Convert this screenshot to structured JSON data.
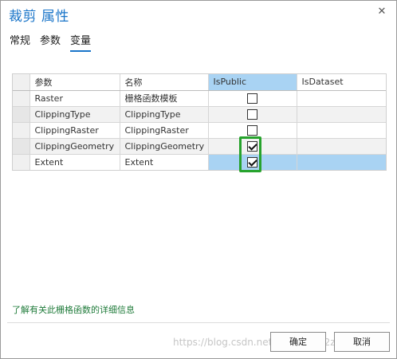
{
  "window": {
    "title": "裁剪 属性",
    "close_glyph": "✕"
  },
  "tabs": [
    {
      "label": "常规",
      "active": false
    },
    {
      "label": "参数",
      "active": false
    },
    {
      "label": "变量",
      "active": true
    }
  ],
  "table": {
    "columns": [
      "参数",
      "名称",
      "IsPublic",
      "IsDataset"
    ],
    "rows": [
      {
        "param": "Raster",
        "name": "栅格函数模板",
        "is_public": false,
        "is_dataset": ""
      },
      {
        "param": "ClippingType",
        "name": "ClippingType",
        "is_public": false,
        "is_dataset": ""
      },
      {
        "param": "ClippingRaster",
        "name": "ClippingRaster",
        "is_public": false,
        "is_dataset": ""
      },
      {
        "param": "ClippingGeometry",
        "name": "ClippingGeometry",
        "is_public": true,
        "is_dataset": ""
      },
      {
        "param": "Extent",
        "name": "Extent",
        "is_public": true,
        "is_dataset": ""
      }
    ],
    "highlight_color": "#27a32d",
    "selection_color": "#a9d3f3"
  },
  "footer": {
    "learn_more": "了解有关此栅格函数的详细信息",
    "ok_label": "确定",
    "cancel_label": "取消"
  },
  "watermark": "https://blog.csdn.net/xingx1c3c2zkz"
}
